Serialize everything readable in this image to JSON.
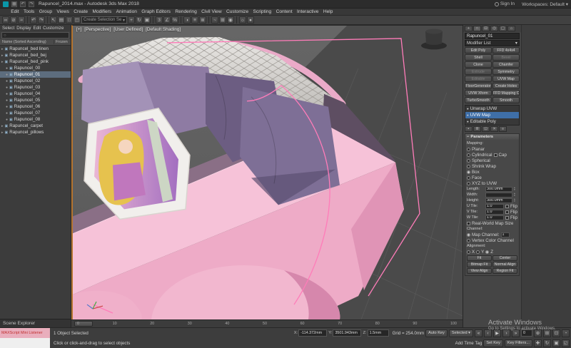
{
  "titlebar": {
    "title": "Rapuncel_2014.max - Autodesk 3ds Max 2018",
    "sign_in": "Sign In",
    "workspaces": "Workspaces: Default"
  },
  "menus": [
    "Edit",
    "Tools",
    "Group",
    "Views",
    "Create",
    "Modifiers",
    "Animation",
    "Graph Editors",
    "Rendering",
    "Civil View",
    "Customize",
    "Scripting",
    "Content",
    "Interactive",
    "Help"
  ],
  "toolbar": {
    "selection_set": "Create Selection Se",
    "icons": [
      {
        "name": "link",
        "glyph": "∞"
      },
      {
        "name": "unlink",
        "glyph": "⊘"
      },
      {
        "name": "bind-spacewarp",
        "glyph": "≈"
      },
      {
        "name": "undo",
        "glyph": "↶"
      },
      {
        "name": "redo",
        "glyph": "↷"
      },
      {
        "name": "select-object",
        "glyph": "↖"
      },
      {
        "name": "select-by-name",
        "glyph": "▤"
      },
      {
        "name": "rect-region",
        "glyph": "□"
      },
      {
        "name": "window-crossing",
        "glyph": "◫"
      },
      {
        "name": "select-move",
        "glyph": "+"
      },
      {
        "name": "select-rotate",
        "glyph": "↻"
      },
      {
        "name": "select-scale",
        "glyph": "▣"
      },
      {
        "name": "snap-toggle",
        "glyph": "3"
      },
      {
        "name": "angle-snap",
        "glyph": "∠"
      },
      {
        "name": "percent-snap",
        "glyph": "%"
      },
      {
        "name": "mirror",
        "glyph": "◑"
      },
      {
        "name": "align",
        "glyph": "≡"
      },
      {
        "name": "layer-manager",
        "glyph": "≣"
      },
      {
        "name": "curve-editor",
        "glyph": "~"
      },
      {
        "name": "schematic-view",
        "glyph": "⊞"
      },
      {
        "name": "material-editor",
        "glyph": "◉"
      },
      {
        "name": "render-setup",
        "glyph": "☼"
      },
      {
        "name": "render",
        "glyph": "●"
      }
    ]
  },
  "icons": {
    "eye": "●",
    "object": "▣",
    "arrow": "▸",
    "down": "▾",
    "search": "○",
    "minus": "−",
    "bulb": "●",
    "plus": "+"
  },
  "explorer": {
    "title": "Scene Explorer",
    "tabs": [
      "Select",
      "Display",
      "Edit",
      "Customize"
    ],
    "name_column": "Name (Sorted Ascending)",
    "frozen_column": "Frozen",
    "items": [
      {
        "label": "Rapuncel_bed linen"
      },
      {
        "label": "Rapuncel_bed_bej"
      },
      {
        "label": "Rapuncel_bed_pink"
      },
      {
        "label": "Rapuncel_00"
      },
      {
        "label": "Rapuncel_01"
      },
      {
        "label": "Rapuncel_02"
      },
      {
        "label": "Rapuncel_03"
      },
      {
        "label": "Rapuncel_04"
      },
      {
        "label": "Rapuncel_05"
      },
      {
        "label": "Rapuncel_06"
      },
      {
        "label": "Rapuncel_07"
      },
      {
        "label": "Rapuncel_08"
      },
      {
        "label": "Rapuncel_carpet"
      },
      {
        "label": "Rapuncel_pillows"
      }
    ]
  },
  "viewport": {
    "labels": [
      "[+]",
      "[Perspective]",
      "[User Defined]",
      "[Default Shading]"
    ]
  },
  "command_panel": {
    "object_name": "Rapuncel_01",
    "modifier_list": "Modifier List",
    "buttons": [
      {
        "label": "Edit Poly"
      },
      {
        "label": "FFD 4x4x4"
      },
      {
        "label": "Shell"
      },
      {
        "label": "Bevel"
      },
      {
        "label": "Clone"
      },
      {
        "label": "Chamfer"
      },
      {
        "label": "Extrude"
      },
      {
        "label": "Symmetry"
      },
      {
        "label": "Editable"
      },
      {
        "label": "UVW Map"
      },
      {
        "label": "FloorGenerator"
      },
      {
        "label": "Create Holes"
      },
      {
        "label": "UVW Xform"
      },
      {
        "label": "FFD Mapping Clear"
      },
      {
        "label": "TurboSmooth"
      },
      {
        "label": "Smooth"
      }
    ],
    "stack": [
      {
        "label": "Unwrap UVW"
      },
      {
        "label": "UVW Map"
      },
      {
        "label": "Editable Poly"
      }
    ],
    "parameters": {
      "title": "Parameters",
      "mapping_label": "Mapping:",
      "options": [
        "Planar",
        "Cylindrical",
        "Spherical",
        "Shrink Wrap",
        "Box",
        "Face",
        "XYZ to UVW"
      ],
      "cap": "Cap",
      "length_label": "Length:",
      "length": "300.0mm",
      "width_label": "Width:",
      "width": "300.0mm",
      "height_label": "Height:",
      "height": "300.0mm",
      "u_label": "U Tile:",
      "u": "1.0",
      "v_label": "V Tile:",
      "v": "1.0",
      "w_label": "W Tile:",
      "w": "1.0",
      "flip": "Flip",
      "real_world": "Real-World Map Size",
      "channel_label": "Channel:",
      "map_channel_label": "Map Channel:",
      "map_channel": "1",
      "vertex_color": "Vertex Color Channel",
      "alignment_label": "Alignment:",
      "axes": [
        "X",
        "Y",
        "Z"
      ],
      "align_buttons": [
        "Fit",
        "Center",
        "Bitmap Fit",
        "Normal Align",
        "View Align",
        "Region Fit"
      ]
    }
  },
  "timeline": {
    "ticks": [
      "0",
      "10",
      "20",
      "30",
      "40",
      "50",
      "60",
      "70",
      "80",
      "90",
      "100"
    ]
  },
  "statusbar": {
    "status": "1 Object Selected",
    "prompt": "Click or click-and-drag to select objects",
    "x_label": "X:",
    "x": "-114.372mm",
    "y_label": "Y:",
    "y": "3501.943mm",
    "z_label": "Z:",
    "z": "1.5mm",
    "grid": "Grid = 254.0mm",
    "add_time_tag": "Add Time Tag",
    "auto_key": "Auto Key",
    "selected_filter": "Selected",
    "set_key": "Set Key",
    "key_filters": "Key Filters...",
    "frame": "0"
  },
  "maxscript": {
    "text": "MAXScript Mini Listener"
  },
  "watermark": {
    "line1": "Activate Windows",
    "line2": "Go to Settings to activate Windows."
  },
  "colors": {
    "floor_dark": "#4a4a4a",
    "tuft_light": "#dddbd8",
    "rail_light": "#f6c2d8",
    "frame_pink": "#eeabc7",
    "frame_shade1": "#e094b6",
    "arm_pink": "#f2b7cf",
    "pillow_1": "#a392b7",
    "pillow_2": "#8e7ba3",
    "pillow_3": "#6c5d82",
    "pillow_4": "#7e6f96",
    "rapunzel_white": "#f1efec",
    "hair_yellow": "#e6c24e",
    "wire_pink": "#ff7cb9",
    "selection_blue": "#3f6fa8",
    "hat_dark": "#2c2c2c"
  }
}
